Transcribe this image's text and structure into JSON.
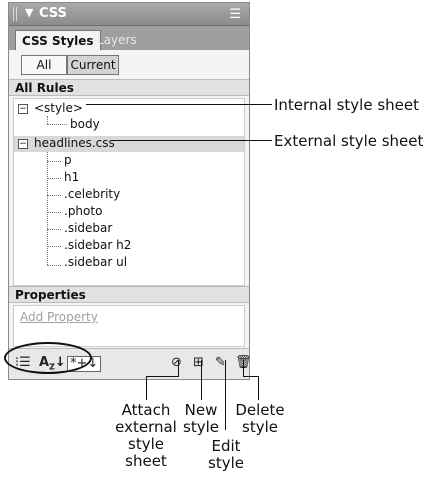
{
  "panel": {
    "title": "CSS",
    "tabs": [
      "CSS Styles",
      "Layers"
    ],
    "mode_buttons": [
      "All",
      "Current"
    ],
    "all_rules_header": "All Rules",
    "tree": {
      "group1": {
        "label": "<style>",
        "children": [
          "body"
        ]
      },
      "group2": {
        "label": "headlines.css",
        "children": [
          "p",
          "h1",
          ".celebrity",
          ".photo",
          ".sidebar",
          ".sidebar h2",
          ".sidebar ul"
        ]
      }
    },
    "properties_header": "Properties",
    "add_property": "Add Property",
    "toolbar_icons": [
      "show-category-view-icon",
      "show-list-view-icon",
      "show-set-properties-icon",
      "attach-style-sheet-icon",
      "new-style-icon",
      "edit-style-icon",
      "delete-style-icon"
    ]
  },
  "callouts": {
    "internal": "Internal style sheet",
    "external": "External style sheet",
    "attach": "Attach\nexternal\nstyle\nsheet",
    "new": "New\nstyle",
    "edit": "Edit\nstyle",
    "delete": "Delete\nstyle"
  }
}
